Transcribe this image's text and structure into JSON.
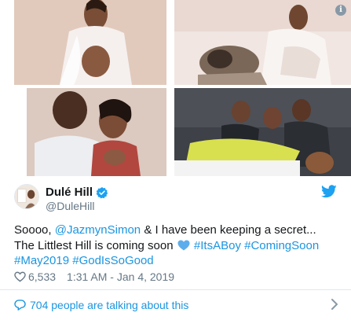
{
  "icons": {
    "info": "info-icon",
    "verified": "verified-badge-icon",
    "bird": "twitter-bird-icon",
    "like": "heart-outline-icon",
    "reply": "speech-bubble-icon",
    "chevron": "chevron-right-icon"
  },
  "photos": [
    {
      "alt": "photo-1"
    },
    {
      "alt": "photo-2"
    },
    {
      "alt": "photo-3"
    },
    {
      "alt": "photo-4"
    }
  ],
  "info_glyph": "i",
  "author": {
    "name": "Dulé Hill",
    "handle": "@DuleHill"
  },
  "tweet": {
    "part1": "Soooo, ",
    "mention": "@JazmynSimon",
    "part2": " & I have been keeping a secret... The Littlest Hill is coming soon ",
    "emoji": "blue-heart",
    "hashtag1": "#ItsABoy",
    "hashtag2": "#ComingSoon",
    "hashtag3": "#May2019",
    "hashtag4": "#GodIsSoGood"
  },
  "stats": {
    "likes": "6,533",
    "timestamp": "1:31 AM - Jan 4, 2019"
  },
  "engagement": {
    "talking_text": "704 people are talking about this"
  },
  "colors": {
    "link": "#1b95e0",
    "text": "#14171a",
    "secondary": "#657786",
    "heart_emoji": "#5dadec"
  }
}
